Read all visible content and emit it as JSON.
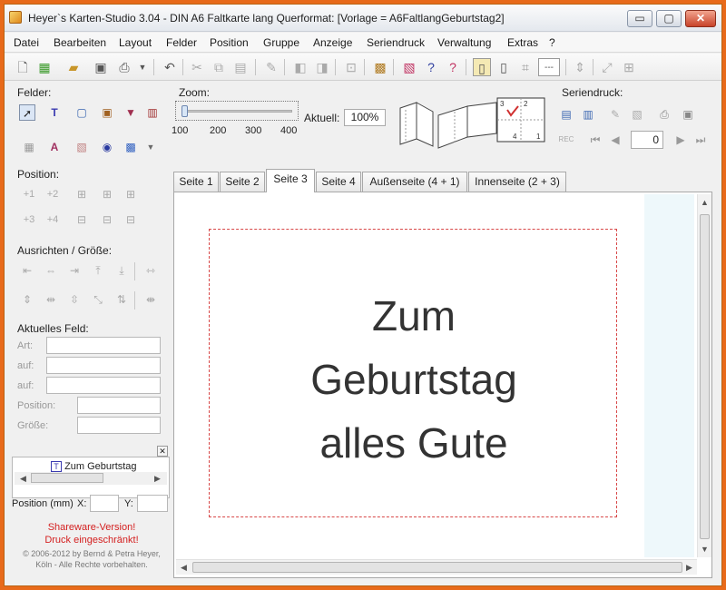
{
  "window": {
    "title": "Heyer`s Karten-Studio 3.04 - DIN A6 Faltkarte lang Querformat: [Vorlage = A6FaltlangGeburtstag2]",
    "minimize_label": "▭",
    "maximize_label": "▢",
    "close_label": "✕"
  },
  "menu": [
    "Datei",
    "Bearbeiten",
    "Layout",
    "Felder",
    "Position",
    "Gruppe",
    "Anzeige",
    "Seriendruck",
    "Verwaltung",
    "Extras",
    "?"
  ],
  "panels": {
    "felder_label": "Felder:",
    "zoom_label": "Zoom:",
    "zoom_ticks": [
      "100",
      "200",
      "300",
      "400"
    ],
    "zoom_level": 0.02,
    "aktuell_label": "Aktuell:",
    "aktuell_value": "100%",
    "seriendruck_label": "Seriendruck:",
    "seriendruck_counter": "0",
    "position_label": "Position:",
    "position_buttons": [
      "+1",
      "+2",
      "+3",
      "+4"
    ],
    "ausrichten_label": "Ausrichten / Größe:",
    "aktuelles_feld_label": "Aktuelles Feld:",
    "field_labels": [
      "Art:",
      "auf:",
      "auf:",
      "Position:",
      "Größe:"
    ],
    "list_item": "Zum Geburtstag",
    "position_mm_label": "Position (mm)",
    "x_label": "X:",
    "y_label": "Y:",
    "shareware_line1": "Shareware-Version!",
    "shareware_line2": "Druck eingeschränkt!",
    "copyright_line1": "© 2006-2012 by Bernd & Petra Heyer,",
    "copyright_line2": "Köln - Alle Rechte vorbehalten."
  },
  "tabs": [
    "Seite 1",
    "Seite 2",
    "Seite 3",
    "Seite 4",
    "Außenseite (4 + 1)",
    "Innenseite (2 + 3)"
  ],
  "active_tab": "Seite 3",
  "card": {
    "line1": "Zum",
    "line2": "Geburtstag",
    "line3": "alles Gute"
  },
  "colors": {
    "frame_border": "#e86a1a",
    "card_border": "#d84848",
    "shareware_text": "#d42020"
  }
}
